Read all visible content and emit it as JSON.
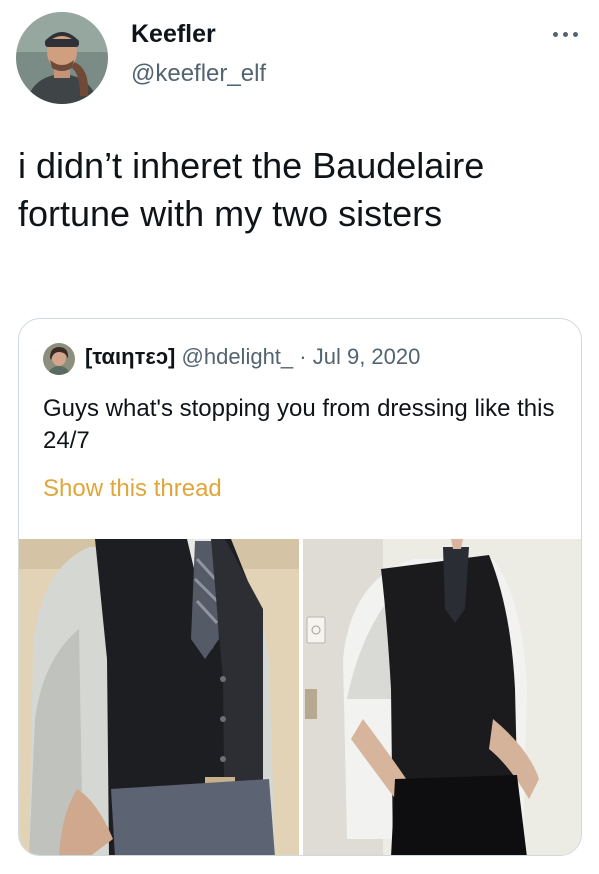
{
  "tweet": {
    "author_name": "Keefler",
    "author_handle": "@keefler_elf",
    "text": "i didn’t inheret the Baudelaire fortune with my two sisters"
  },
  "quoted": {
    "author_name": "[ταιηтεᴐ]",
    "author_handle": "@hdelight_",
    "separator": "·",
    "date": "Jul 9, 2020",
    "text": "Guys what's stopping you from dressing like this 24/7",
    "show_thread": "Show this thread"
  },
  "icons": {
    "more": "more-horizontal-icon"
  },
  "colors": {
    "text": "#0f1419",
    "secondary": "#536471",
    "border": "#cfd9de",
    "link": "#e1a63a"
  }
}
